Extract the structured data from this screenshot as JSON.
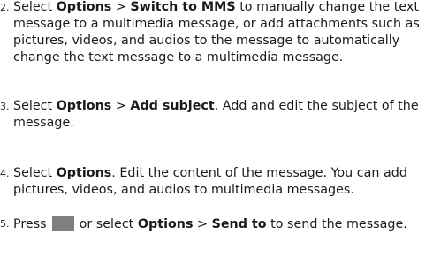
{
  "steps": [
    {
      "number": "2.",
      "select": "Select",
      "options": "Options",
      "sep": ">",
      "action": "Switch to MMS",
      "rest": "to manually change the text message to a multimedia message, or add attachments such as pictures, videos, and audios to the message to automatically change the text message to a multimedia message."
    },
    {
      "number": "3.",
      "select": "Select",
      "options": "Options",
      "sep": ">",
      "action": "Add subject",
      "rest": ". Add and edit the subject of the message."
    },
    {
      "number": "4.",
      "select": "Select",
      "options": "Options",
      "rest": ". Edit the content of the message. You can add pictures, videos, and audios to multimedia messages."
    },
    {
      "number": "5.",
      "press": "Press",
      "or_select": "or select",
      "options": "Options",
      "sep": ">",
      "action": "Send to",
      "rest": "to send the message.",
      "key_icon": "send-key-icon"
    }
  ]
}
